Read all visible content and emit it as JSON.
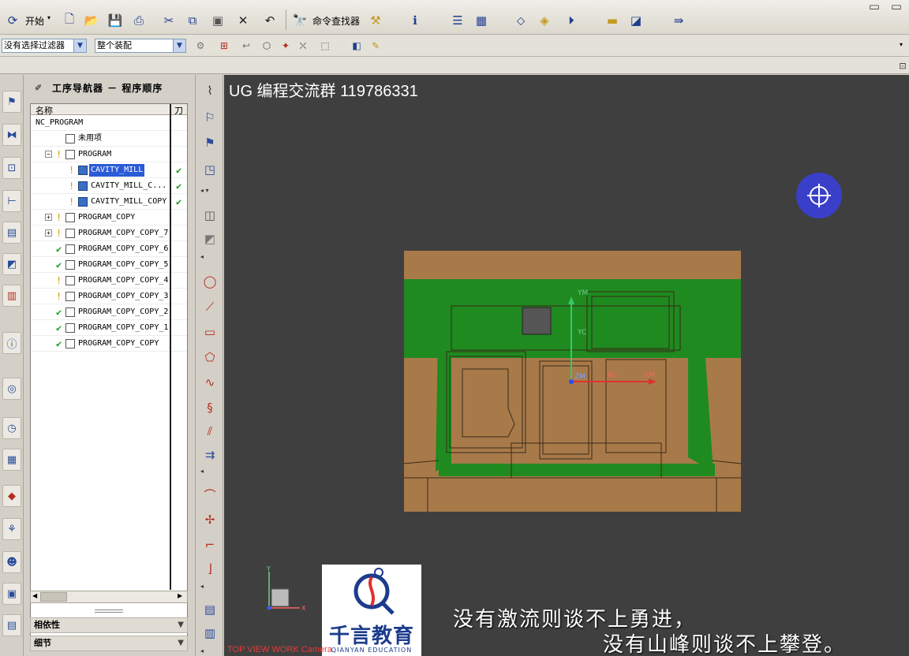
{
  "toolbar": {
    "start_label": "开始",
    "command_finder_label": "命令查找器",
    "selection_filter": "没有选择过滤器",
    "assembly_scope": "整个装配"
  },
  "navigator": {
    "title": "工序导航器 － 程序顺序",
    "columns": {
      "name": "名称",
      "tool": "刀"
    },
    "rows": [
      {
        "name": "NC_PROGRAM",
        "status": "none",
        "indent": 0,
        "expander": "",
        "icon": "none"
      },
      {
        "name": "未用项",
        "status": "none",
        "indent": 1,
        "expander": "",
        "icon": "folder"
      },
      {
        "name": "PROGRAM",
        "status": "warn",
        "indent": 1,
        "expander": "−",
        "icon": "folder"
      },
      {
        "name": "CAVITY_MILL",
        "status": "warn",
        "indent": 2,
        "expander": "",
        "icon": "op",
        "selected": true,
        "check": "✔"
      },
      {
        "name": "CAVITY_MILL_C...",
        "status": "warn",
        "indent": 2,
        "expander": "",
        "icon": "op",
        "check": "✔"
      },
      {
        "name": "CAVITY_MILL_COPY",
        "status": "warn",
        "indent": 2,
        "expander": "",
        "icon": "op",
        "check": "✔"
      },
      {
        "name": "PROGRAM_COPY",
        "status": "warn",
        "indent": 1,
        "expander": "+",
        "icon": "folder"
      },
      {
        "name": "PROGRAM_COPY_COPY_7",
        "status": "warn",
        "indent": 1,
        "expander": "+",
        "icon": "folder"
      },
      {
        "name": "PROGRAM_COPY_COPY_6",
        "status": "ok",
        "indent": 1,
        "expander": "",
        "icon": "folder"
      },
      {
        "name": "PROGRAM_COPY_COPY_5",
        "status": "ok",
        "indent": 1,
        "expander": "",
        "icon": "folder"
      },
      {
        "name": "PROGRAM_COPY_COPY_4",
        "status": "warn",
        "indent": 1,
        "expander": "",
        "icon": "folder"
      },
      {
        "name": "PROGRAM_COPY_COPY_3",
        "status": "warn",
        "indent": 1,
        "expander": "",
        "icon": "folder"
      },
      {
        "name": "PROGRAM_COPY_COPY_2",
        "status": "ok",
        "indent": 1,
        "expander": "",
        "icon": "folder"
      },
      {
        "name": "PROGRAM_COPY_COPY_1",
        "status": "ok",
        "indent": 1,
        "expander": "",
        "icon": "folder"
      },
      {
        "name": "PROGRAM_COPY_COPY",
        "status": "ok",
        "indent": 1,
        "expander": "",
        "icon": "folder"
      }
    ],
    "sections": {
      "dependencies": "相依性",
      "details": "细节"
    }
  },
  "viewport": {
    "watermark_title": "UG 编程交流群 119786331",
    "view_label": "TOP VIEW WORK Camera",
    "axis_labels": {
      "ym": "YM",
      "xm": "XM",
      "zm": "ZM",
      "yc": "YC",
      "xc": "XC",
      "y": "Y",
      "x": "X"
    },
    "colors": {
      "background": "#3f3f3f",
      "part": "#a87a4a",
      "cut_region": "#1f8a1f",
      "accent_circle": "#3a3fc9"
    }
  },
  "logo": {
    "name": "千言教育",
    "sub": "QIANYAN EDUCATION"
  },
  "subtitles": {
    "line1": "没有激流则谈不上勇进，",
    "line2": "没有山峰则谈不上攀登。"
  }
}
